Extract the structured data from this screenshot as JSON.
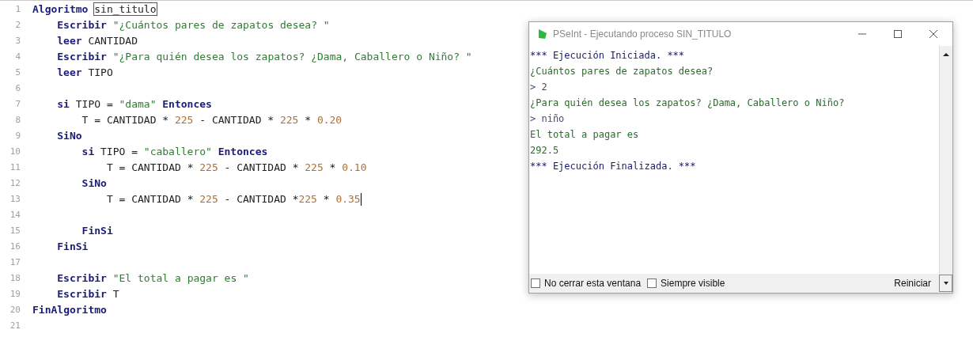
{
  "editor": {
    "lines": [
      {
        "number": "1",
        "tokens": [
          {
            "kind": "keyword",
            "text": "Algoritmo"
          },
          {
            "kind": "matched",
            "text": "sin_titulo",
            "space_before": true
          }
        ],
        "children": [
          {
            "number": "2",
            "tokens": [
              {
                "kind": "keyword",
                "text": "Escribir"
              },
              {
                "kind": "string",
                "text": "\"¿Cuántos pares de zapatos desea? \"",
                "space_before": true
              }
            ]
          },
          {
            "number": "3",
            "tokens": [
              {
                "kind": "keyword",
                "text": "leer"
              },
              {
                "kind": "plain",
                "text": "CANTIDAD",
                "space_before": true
              }
            ]
          },
          {
            "number": "4",
            "tokens": [
              {
                "kind": "keyword",
                "text": "Escribir"
              },
              {
                "kind": "string",
                "text": "\"¿Para quién desea los zapatos? ¿Dama, Caballero o Niño? \"",
                "space_before": true
              }
            ]
          },
          {
            "number": "5",
            "tokens": [
              {
                "kind": "keyword",
                "text": "leer"
              },
              {
                "kind": "plain",
                "text": "TIPO",
                "space_before": true
              }
            ]
          },
          {
            "number": "6"
          },
          {
            "number": "7",
            "tokens": [
              {
                "kind": "keyword",
                "text": "si"
              },
              {
                "kind": "plain",
                "text": "TIPO =",
                "space_before": true
              },
              {
                "kind": "string",
                "text": "\"dama\"",
                "space_before": true
              },
              {
                "kind": "keyword",
                "text": "Entonces",
                "space_before": true
              }
            ],
            "children": [
              {
                "number": "8",
                "tokens": [
                  {
                    "kind": "plain",
                    "text": "T = CANTIDAD *"
                  },
                  {
                    "kind": "number",
                    "text": "225",
                    "space_before": true
                  },
                  {
                    "kind": "plain",
                    "text": "- CANTIDAD *",
                    "space_before": true
                  },
                  {
                    "kind": "number",
                    "text": "225",
                    "space_before": true
                  },
                  {
                    "kind": "plain",
                    "text": "*",
                    "space_before": true
                  },
                  {
                    "kind": "number",
                    "text": "0.20",
                    "space_before": true
                  }
                ]
              }
            ]
          },
          {
            "number": "9",
            "tokens": [
              {
                "kind": "keyword",
                "text": "SiNo"
              }
            ],
            "children": [
              {
                "number": "10",
                "tokens": [
                  {
                    "kind": "keyword",
                    "text": "si"
                  },
                  {
                    "kind": "plain",
                    "text": "TIPO =",
                    "space_before": true
                  },
                  {
                    "kind": "string",
                    "text": "\"caballero\"",
                    "space_before": true
                  },
                  {
                    "kind": "keyword",
                    "text": "Entonces",
                    "space_before": true
                  }
                ],
                "children": [
                  {
                    "number": "11",
                    "tokens": [
                      {
                        "kind": "plain",
                        "text": "T = CANTIDAD *"
                      },
                      {
                        "kind": "number",
                        "text": "225",
                        "space_before": true
                      },
                      {
                        "kind": "plain",
                        "text": "- CANTIDAD *",
                        "space_before": true
                      },
                      {
                        "kind": "number",
                        "text": "225",
                        "space_before": true
                      },
                      {
                        "kind": "plain",
                        "text": "*",
                        "space_before": true
                      },
                      {
                        "kind": "number",
                        "text": "0.10",
                        "space_before": true
                      }
                    ]
                  }
                ]
              },
              {
                "number": "12",
                "tokens": [
                  {
                    "kind": "keyword",
                    "text": "SiNo"
                  }
                ],
                "children": [
                  {
                    "number": "13",
                    "caret": true,
                    "tokens": [
                      {
                        "kind": "plain",
                        "text": "T = CANTIDAD *"
                      },
                      {
                        "kind": "number",
                        "text": "225",
                        "space_before": true
                      },
                      {
                        "kind": "plain",
                        "text": "- CANTIDAD *",
                        "space_before": true
                      },
                      {
                        "kind": "number",
                        "text": "225"
                      },
                      {
                        "kind": "plain",
                        "text": "*",
                        "space_before": true
                      },
                      {
                        "kind": "number",
                        "text": "0.35",
                        "space_before": true
                      }
                    ]
                  },
                  {
                    "number": "14"
                  }
                ]
              },
              {
                "number": "15",
                "tokens": [
                  {
                    "kind": "keyword",
                    "text": "FinSi"
                  }
                ]
              }
            ]
          },
          {
            "number": "16",
            "tokens": [
              {
                "kind": "keyword",
                "text": "FinSi"
              }
            ]
          },
          {
            "number": "17"
          },
          {
            "number": "18",
            "tokens": [
              {
                "kind": "keyword",
                "text": "Escribir"
              },
              {
                "kind": "string",
                "text": "\"El total a pagar es \"",
                "space_before": true
              }
            ]
          },
          {
            "number": "19",
            "tokens": [
              {
                "kind": "keyword",
                "text": "Escribir"
              },
              {
                "kind": "plain",
                "text": "T",
                "space_before": true
              }
            ]
          }
        ]
      },
      {
        "number": "20",
        "tokens": [
          {
            "kind": "keyword",
            "text": "FinAlgoritmo"
          }
        ]
      },
      {
        "number": "21"
      }
    ]
  },
  "console_window": {
    "title": "PSeInt - Ejecutando proceso SIN_TITULO",
    "lines": [
      {
        "kind": "info",
        "text": "*** Ejecución Iniciada. ***"
      },
      {
        "kind": "output",
        "text": "¿Cuántos pares de zapatos desea?"
      },
      {
        "kind": "input",
        "text": "> 2"
      },
      {
        "kind": "output",
        "text": "¿Para quién desea los zapatos? ¿Dama, Caballero o Niño?"
      },
      {
        "kind": "input",
        "text": "> niño"
      },
      {
        "kind": "output",
        "text": "El total a pagar es"
      },
      {
        "kind": "output",
        "text": "292.5"
      },
      {
        "kind": "info",
        "text": "*** Ejecución Finalizada. ***"
      }
    ],
    "options": [
      {
        "label": "No cerrar esta ventana",
        "checked": false
      },
      {
        "label": "Siempre visible",
        "checked": false
      }
    ],
    "button": "Reiniciar"
  }
}
